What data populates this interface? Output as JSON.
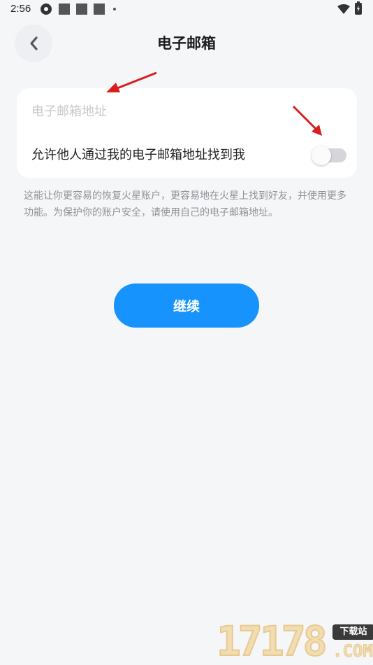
{
  "status_bar": {
    "time": "2:56",
    "icons": [
      "app-notification-icon",
      "square-icon",
      "square-icon",
      "square-icon",
      "dot-icon",
      "wifi-icon",
      "battery-charging-icon"
    ]
  },
  "header": {
    "back_icon": "chevron-left-icon",
    "title": "电子邮箱"
  },
  "form": {
    "email_placeholder": "电子邮箱地址",
    "email_value": "",
    "toggle_label": "允许他人通过我的电子邮箱地址找到我",
    "toggle_on": false
  },
  "hint": "这能让你更容易的恢复火星账户，更容易地在火星上找到好友，并使用更多功能。为保护你的账户安全，请使用自己的电子邮箱地址。",
  "continue_label": "继续",
  "colors": {
    "background": "#f5f6f8",
    "card": "#ffffff",
    "accent": "#1793fe",
    "annotation_arrow": "#d81e1e"
  },
  "watermark": {
    "number": "17178",
    "badge": "下载站",
    "suffix": ".COM"
  }
}
